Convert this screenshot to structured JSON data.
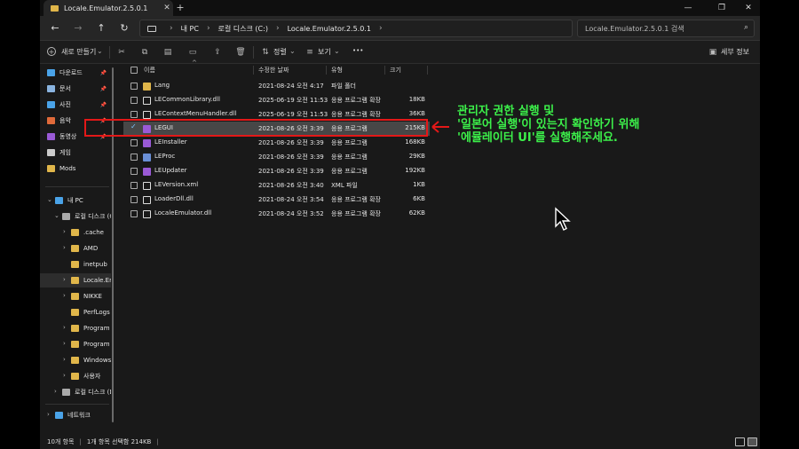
{
  "window": {
    "tab_title": "Locale.Emulator.2.5.0.1",
    "new_tab": "+",
    "controls": {
      "minimize": "—",
      "maximize": "❐",
      "close": "✕"
    }
  },
  "nav": {
    "back": "←",
    "forward": "→",
    "up": "↑",
    "refresh": "↻",
    "breadcrumbs": [
      "내 PC",
      "로컬 디스크 (C:)",
      "Locale.Emulator.2.5.0.1"
    ],
    "more_chevron": "›",
    "search_placeholder": "Locale.Emulator.2.5.0.1 검색"
  },
  "toolbar": {
    "new_label": "새로 만들기",
    "sort_label": "정렬",
    "view_label": "보기",
    "more": "•••",
    "details_label": "세부 정보",
    "icons": [
      "cut-icon",
      "copy-icon",
      "paste-icon",
      "rename-icon",
      "share-icon",
      "delete-icon"
    ]
  },
  "sidebar": {
    "quick": [
      {
        "label": "다운로드",
        "icon": "download-icon",
        "color": "#4aa3e8",
        "pinned": true
      },
      {
        "label": "문서",
        "icon": "document-icon",
        "color": "#8ab4e0",
        "pinned": true
      },
      {
        "label": "사진",
        "icon": "pictures-icon",
        "color": "#4aa3e8",
        "pinned": true
      },
      {
        "label": "음악",
        "icon": "music-icon",
        "color": "#e06a3a",
        "pinned": true
      },
      {
        "label": "동영상",
        "icon": "video-icon",
        "color": "#9a5ad6",
        "pinned": true
      },
      {
        "label": "게임",
        "icon": "game-icon",
        "color": "#cccccc",
        "pinned": false
      },
      {
        "label": "Mods",
        "icon": "folder-icon",
        "color": "#e0b64a",
        "pinned": false
      }
    ],
    "tree": [
      {
        "label": "내 PC",
        "level": 0,
        "chev": "⌄",
        "icon": "pc-icon",
        "color": "#4aa3e8"
      },
      {
        "label": "로컬 디스크 (C:)",
        "level": 1,
        "chev": "⌄",
        "icon": "drive-icon",
        "color": "#aaaaaa"
      },
      {
        "label": ".cache",
        "level": 2,
        "chev": "›",
        "icon": "folder-icon",
        "color": "#e0b64a"
      },
      {
        "label": "AMD",
        "level": 2,
        "chev": "›",
        "icon": "folder-icon",
        "color": "#e0b64a"
      },
      {
        "label": "inetpub",
        "level": 2,
        "chev": "",
        "icon": "folder-icon",
        "color": "#e0b64a"
      },
      {
        "label": "Locale.Emulator.2.5.0.1",
        "level": 2,
        "chev": "›",
        "icon": "folder-icon",
        "color": "#e0b64a",
        "selected": true
      },
      {
        "label": "NIKKE",
        "level": 2,
        "chev": "›",
        "icon": "folder-icon",
        "color": "#e0b64a"
      },
      {
        "label": "PerfLogs",
        "level": 2,
        "chev": "",
        "icon": "folder-icon",
        "color": "#e0b64a"
      },
      {
        "label": "Program Files",
        "level": 2,
        "chev": "›",
        "icon": "folder-icon",
        "color": "#e0b64a"
      },
      {
        "label": "Program Files (x86)",
        "level": 2,
        "chev": "›",
        "icon": "folder-icon",
        "color": "#e0b64a"
      },
      {
        "label": "Windows",
        "level": 2,
        "chev": "›",
        "icon": "folder-icon",
        "color": "#e0b64a"
      },
      {
        "label": "사용자",
        "level": 2,
        "chev": "›",
        "icon": "folder-icon",
        "color": "#e0b64a"
      },
      {
        "label": "로컬 디스크 (D:)",
        "level": 1,
        "chev": "›",
        "icon": "drive-icon",
        "color": "#aaaaaa"
      },
      {
        "label": "네트워크",
        "level": 0,
        "chev": "›",
        "icon": "network-icon",
        "color": "#4aa3e8"
      }
    ]
  },
  "columns": {
    "name": "이름",
    "date": "수정한 날짜",
    "type": "유형",
    "size": "크기",
    "sort_indicator": "^"
  },
  "files": [
    {
      "name": "Lang",
      "date": "2021-08-24 오전 4:17",
      "type": "파일 폴더",
      "size": "",
      "icon": "folder-icon",
      "color": "#e0b64a"
    },
    {
      "name": "LECommonLibrary.dll",
      "date": "2025-06-19 오전 11:53",
      "type": "응용 프로그램 확장",
      "size": "18KB",
      "icon": "dll-file-icon",
      "color": "#dddddd"
    },
    {
      "name": "LEContextMenuHandler.dll",
      "date": "2025-06-19 오전 11:53",
      "type": "응용 프로그램 확장",
      "size": "36KB",
      "icon": "dll-file-icon",
      "color": "#dddddd"
    },
    {
      "name": "LEGUI",
      "date": "2021-08-26 오전 3:39",
      "type": "응용 프로그램",
      "size": "215KB",
      "icon": "app-icon",
      "color": "#9a5ad6",
      "selected": true
    },
    {
      "name": "LEInstaller",
      "date": "2021-08-26 오전 3:39",
      "type": "응용 프로그램",
      "size": "168KB",
      "icon": "app-icon",
      "color": "#9a5ad6"
    },
    {
      "name": "LEProc",
      "date": "2021-08-26 오전 3:39",
      "type": "응용 프로그램",
      "size": "29KB",
      "icon": "exe-icon",
      "color": "#6a8fd6"
    },
    {
      "name": "LEUpdater",
      "date": "2021-08-26 오전 3:39",
      "type": "응용 프로그램",
      "size": "192KB",
      "icon": "app-icon",
      "color": "#9a5ad6"
    },
    {
      "name": "LEVersion.xml",
      "date": "2021-08-26 오전 3:40",
      "type": "XML 파일",
      "size": "1KB",
      "icon": "xml-file-icon",
      "color": "#dddddd"
    },
    {
      "name": "LoaderDll.dll",
      "date": "2021-08-24 오전 3:54",
      "type": "응용 프로그램 확장",
      "size": "6KB",
      "icon": "dll-file-icon",
      "color": "#dddddd"
    },
    {
      "name": "LocaleEmulator.dll",
      "date": "2021-08-24 오전 3:52",
      "type": "응용 프로그램 확장",
      "size": "62KB",
      "icon": "dll-file-icon",
      "color": "#dddddd"
    }
  ],
  "annotation": {
    "lines": [
      "관리자 권한 실행 및",
      "'일본어 실행'이 있는지 확인하기 위해",
      "'에뮬레이터 UI'를 실행해주세요."
    ],
    "arrow": "⇐",
    "color": "#3cf04a",
    "highlight_color": "#e31818"
  },
  "status": {
    "count": "10개 항목",
    "selection": "1개 항목 선택함 214KB",
    "sep": "|"
  }
}
